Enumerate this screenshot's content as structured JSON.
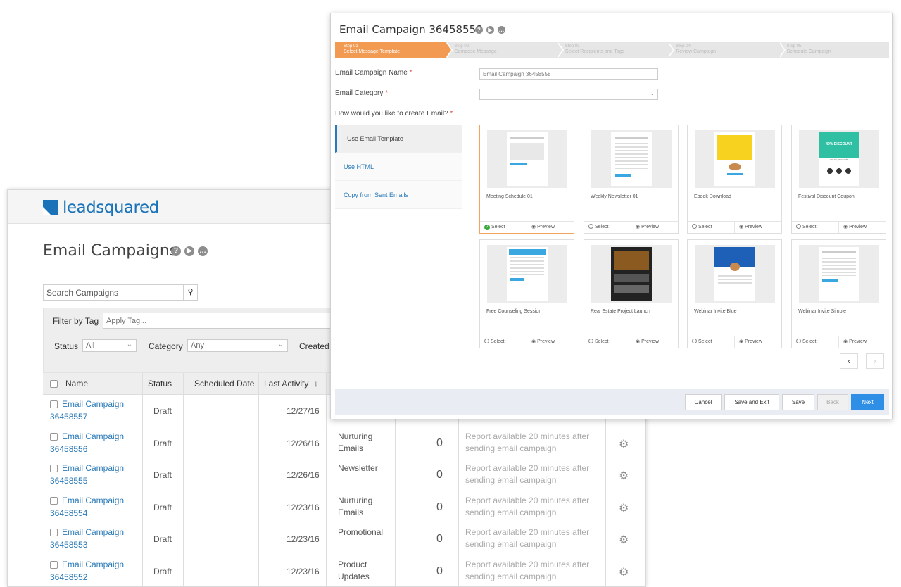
{
  "list_page": {
    "logo_text": "leadsquared",
    "title": "Email Campaigns",
    "search": {
      "placeholder": "Search Campaigns"
    },
    "filters": {
      "tag_label": "Filter by Tag",
      "tag_placeholder": "Apply Tag...",
      "status_label": "Status",
      "status_value": "All",
      "category_label": "Category",
      "category_value": "Any",
      "created_label": "Created I"
    },
    "columns": {
      "name": "Name",
      "status": "Status",
      "scheduled_date": "Scheduled Date",
      "last_activity": "Last Activity",
      "sort_icon": "↓"
    },
    "rows": [
      {
        "name_line1": "Email Campaign",
        "name_line2": "36458557",
        "status": "Draft",
        "date": "12/27/16",
        "category_line1": "",
        "category_line2": "",
        "count": "",
        "report_line1": "",
        "report_line2": ""
      },
      {
        "name_line1": "Email Campaign",
        "name_line2": "36458556",
        "status": "Draft",
        "date": "12/26/16",
        "category_line1": "Nurturing",
        "category_line2": "Emails",
        "count": "0",
        "report_line1": "Report available 20 minutes after",
        "report_line2": "sending email campaign"
      },
      {
        "name_line1": "Email Campaign",
        "name_line2": "36458555",
        "status": "Draft",
        "date": "12/26/16",
        "category_line1": "Newsletter",
        "category_line2": "",
        "count": "0",
        "report_line1": "Report available 20 minutes after",
        "report_line2": "sending email campaign"
      },
      {
        "name_line1": "Email Campaign",
        "name_line2": "36458554",
        "status": "Draft",
        "date": "12/23/16",
        "category_line1": "Nurturing",
        "category_line2": "Emails",
        "count": "0",
        "report_line1": "Report available 20 minutes after",
        "report_line2": "sending email campaign"
      },
      {
        "name_line1": "Email Campaign",
        "name_line2": "36458553",
        "status": "Draft",
        "date": "12/23/16",
        "category_line1": "Promotional",
        "category_line2": "",
        "count": "0",
        "report_line1": "Report available 20 minutes after",
        "report_line2": "sending email campaign"
      },
      {
        "name_line1": "Email Campaign",
        "name_line2": "36458552",
        "status": "Draft",
        "date": "12/23/16",
        "category_line1": "Product",
        "category_line2": "Updates",
        "count": "0",
        "report_line1": "Report available 20 minutes after",
        "report_line2": "sending email campaign"
      }
    ]
  },
  "modal": {
    "title": "Email Campaign 36458558",
    "steps": [
      {
        "num": "Step 01",
        "label": "Select Message Template"
      },
      {
        "num": "Step 02",
        "label": "Compose Message"
      },
      {
        "num": "Step 03",
        "label": "Select Recipients and Tags"
      },
      {
        "num": "Step 04",
        "label": "Review Campaign"
      },
      {
        "num": "Step 05",
        "label": "Schedule Campaign"
      }
    ],
    "name_label": "Email Campaign Name",
    "name_value": "Email Campaign 36458558",
    "category_label": "Email Category",
    "category_value": "",
    "create_label": "How would you like to create Email?",
    "required_mark": "*",
    "options": [
      "Use Email Template",
      "Use HTML",
      "Copy from Sent Emails"
    ],
    "select_label": "Select",
    "preview_label": "Preview",
    "templates": [
      {
        "name": "Meeting Schedule 01"
      },
      {
        "name": "Weekly Newsletter 01"
      },
      {
        "name": "Ebook Download"
      },
      {
        "name": "Festival Discount Coupon",
        "banner": "40% DISCOUNT",
        "banner_sub": "on all products"
      },
      {
        "name": "Free Counseling Session"
      },
      {
        "name": "Real Estate Project Launch"
      },
      {
        "name": "Webinar Invite Blue"
      },
      {
        "name": "Webinar Invite Simple"
      }
    ],
    "pager": {
      "prev": "‹",
      "next": "›"
    },
    "footer": {
      "cancel": "Cancel",
      "save_exit": "Save and Exit",
      "save": "Save",
      "back": "Back",
      "next": "Next"
    }
  },
  "colors": {
    "accent": "#2a7ab8",
    "step_active": "#f39a52",
    "primary_button": "#2f8ee5",
    "selected_check": "#3aa83a"
  }
}
